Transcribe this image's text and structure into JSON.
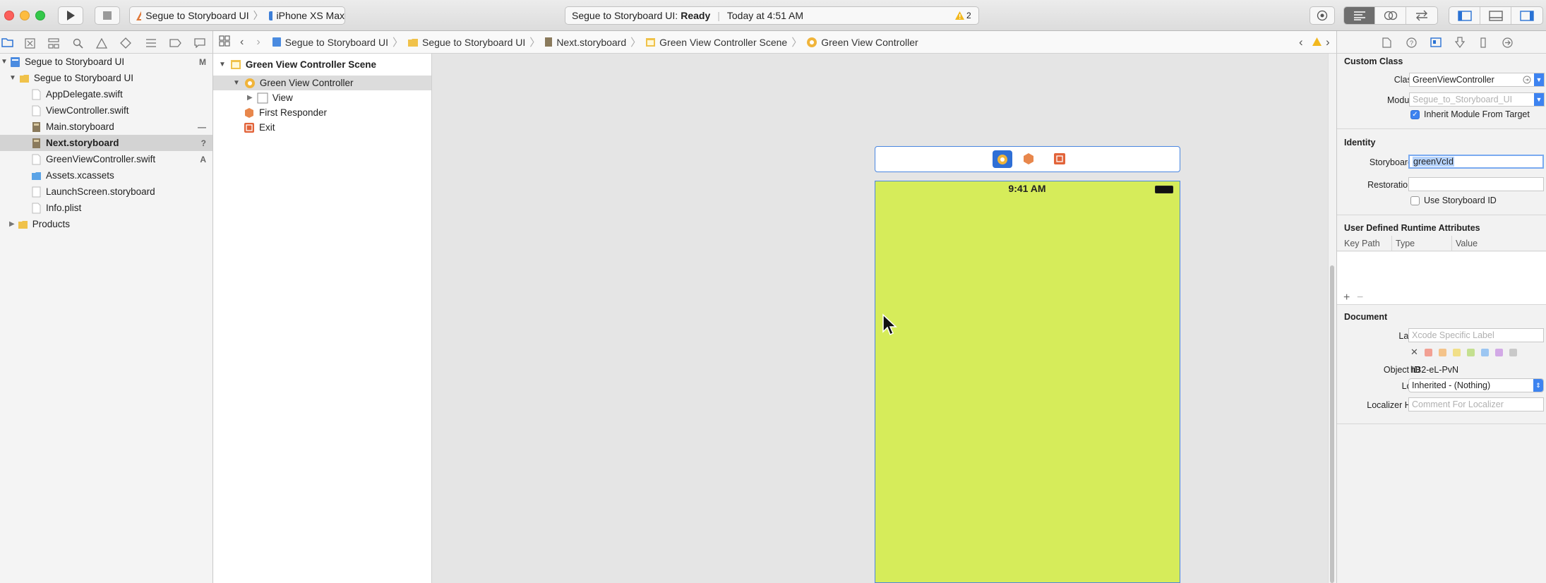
{
  "toolbar": {
    "scheme": "Segue to Storyboard UI",
    "device": "iPhone XS Max",
    "status_project": "Segue to Storyboard UI:",
    "status_state": "Ready",
    "status_time": "Today at 4:51 AM",
    "warning_count": "2"
  },
  "navigator": {
    "items": [
      {
        "label": "Segue to Storyboard UI",
        "badge": "M"
      },
      {
        "label": "Segue to Storyboard UI",
        "badge": ""
      },
      {
        "label": "AppDelegate.swift",
        "badge": ""
      },
      {
        "label": "ViewController.swift",
        "badge": ""
      },
      {
        "label": "Main.storyboard",
        "badge": "—"
      },
      {
        "label": "Next.storyboard",
        "badge": "?"
      },
      {
        "label": "GreenViewController.swift",
        "badge": "A"
      },
      {
        "label": "Assets.xcassets",
        "badge": ""
      },
      {
        "label": "LaunchScreen.storyboard",
        "badge": ""
      },
      {
        "label": "Info.plist",
        "badge": ""
      },
      {
        "label": "Products",
        "badge": ""
      }
    ]
  },
  "jumpbar": {
    "crumbs": [
      "Segue to Storyboard UI",
      "Segue to Storyboard UI",
      "Next.storyboard",
      "Green View Controller Scene",
      "Green View Controller"
    ]
  },
  "outline": {
    "scene": "Green View Controller Scene",
    "controller": "Green View Controller",
    "view": "View",
    "responder": "First Responder",
    "exit": "Exit"
  },
  "canvas": {
    "status_time": "9:41 AM",
    "background_color": "#d6ec5a"
  },
  "inspector": {
    "custom_class": {
      "title": "Custom Class",
      "class_label": "Class",
      "class_value": "GreenViewController",
      "module_label": "Module",
      "module_placeholder": "Segue_to_Storyboard_UI",
      "inherit_label": "Inherit Module From Target"
    },
    "identity": {
      "title": "Identity",
      "storyboard_id_label": "Storyboard ID",
      "storyboard_id_value": "greenVcId",
      "restoration_id_label": "Restoration ID",
      "restoration_id_value": "",
      "use_storyboard_label": "Use Storyboard ID"
    },
    "runtime": {
      "title": "User Defined Runtime Attributes",
      "columns": [
        "Key Path",
        "Type",
        "Value"
      ]
    },
    "document": {
      "title": "Document",
      "label_label": "Label",
      "label_placeholder": "Xcode Specific Label",
      "object_id_label": "Object ID",
      "object_id_value": "hB2-eL-PvN",
      "lock_label": "Lock",
      "lock_value": "Inherited - (Nothing)",
      "localizer_label": "Localizer Hint",
      "localizer_placeholder": "Comment For Localizer",
      "label_colors": [
        "#f2a093",
        "#f4c38a",
        "#f1df88",
        "#c4e090",
        "#9cc6f2",
        "#d2a9e6",
        "#c9c9c9"
      ]
    }
  }
}
